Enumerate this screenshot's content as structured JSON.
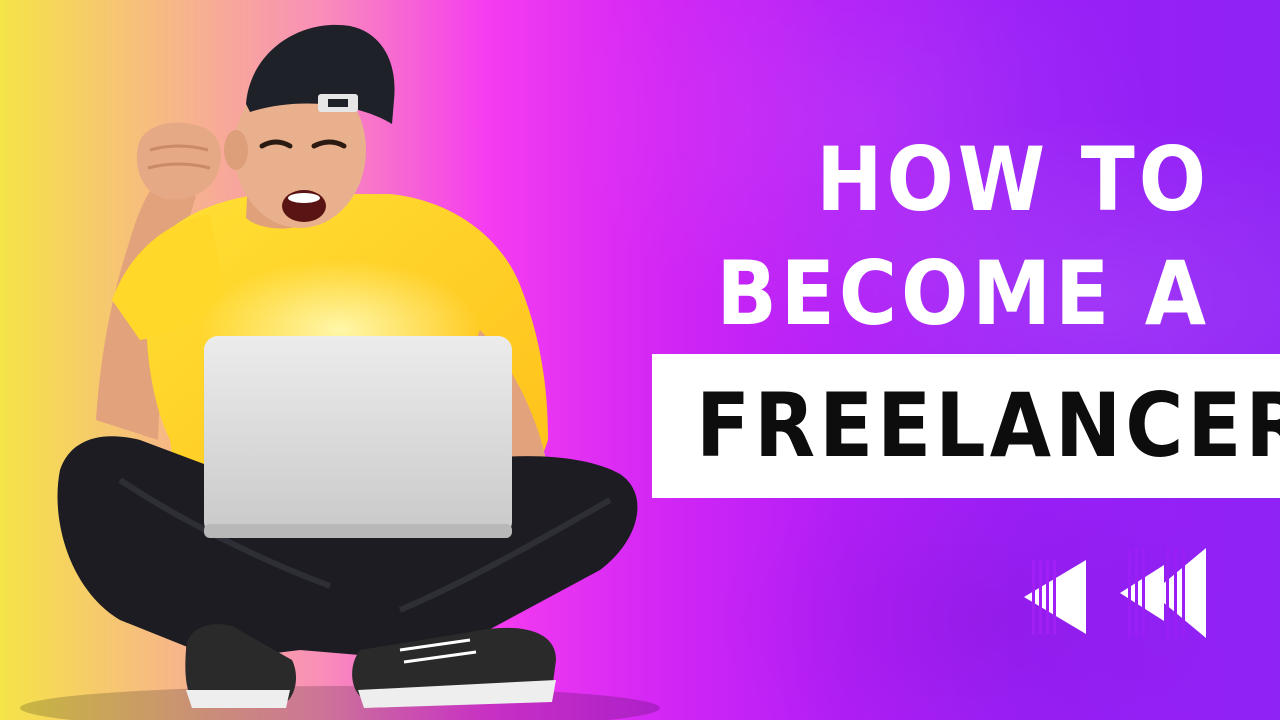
{
  "headline": {
    "line_1": "HOW TO",
    "line_2": "BECOME A",
    "highlight": "FREELANCER"
  },
  "colors": {
    "gradient_left": "#f5e447",
    "gradient_mid": "#f53cf0",
    "gradient_right": "#8f22f5",
    "headline_text": "#ffffff",
    "highlight_box": "#ffffff",
    "highlight_text": "#0d0d0d",
    "shirt": "#ffd21f",
    "jeans": "#1c1c22",
    "laptop": "#dcdcdc"
  },
  "icons": [
    "rewind-icon",
    "rewind-icon"
  ]
}
